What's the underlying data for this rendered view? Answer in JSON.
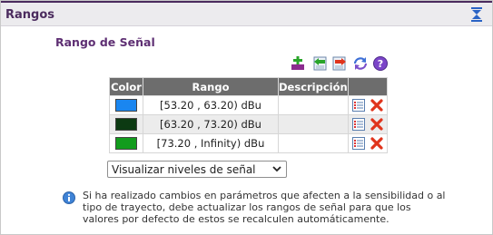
{
  "panel": {
    "title": "Rangos"
  },
  "section": {
    "title": "Rango de Señal"
  },
  "toolbar": {
    "icons": [
      "add-icon",
      "import-icon",
      "export-icon",
      "refresh-icon",
      "help-icon"
    ]
  },
  "table": {
    "headers": {
      "color": "Color",
      "rango": "Rango",
      "descripcion": "Descripción"
    },
    "rows": [
      {
        "color": "#1a86f0",
        "rango": "[53.20 , 63.20) dBu",
        "descripcion": ""
      },
      {
        "color": "#0c3a12",
        "rango": "[63.20 , 73.20) dBu",
        "descripcion": ""
      },
      {
        "color": "#129c1d",
        "rango": "[73.20 , Infinity) dBu",
        "descripcion": ""
      }
    ]
  },
  "select": {
    "value": "Visualizar niveles de señal"
  },
  "info": {
    "text": "Si ha realizado cambios en parámetros que afecten a la sensibilidad o al tipo de trayecto, debe actualizar los rangos de señal para que los valores por defecto de estos se recalculen automáticamente."
  },
  "colors": {
    "accent": "#4b2b5e",
    "header_bg": "#6d6d6d",
    "delete": "#e0341c"
  }
}
